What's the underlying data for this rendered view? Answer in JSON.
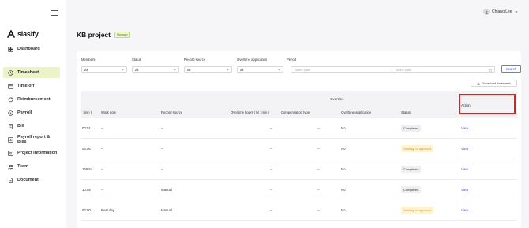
{
  "sidebar": {
    "logo": "slasify",
    "items": [
      {
        "label": "Dashboard",
        "icon": "dashboard-icon"
      },
      {
        "label": "Timesheet",
        "icon": "clock-icon"
      },
      {
        "label": "Time off",
        "icon": "calendar-icon"
      },
      {
        "label": "Reimbursement",
        "icon": "refresh-icon"
      },
      {
        "label": "Payroll",
        "icon": "payroll-icon"
      },
      {
        "label": "Bill",
        "icon": "bill-icon"
      },
      {
        "label": "Payroll report & Bills",
        "icon": "report-icon"
      },
      {
        "label": "Project Information",
        "icon": "project-icon"
      },
      {
        "label": "Team",
        "icon": "team-icon"
      },
      {
        "label": "Document",
        "icon": "document-icon"
      }
    ],
    "active": "Timesheet"
  },
  "header": {
    "user_name": "Chiang Lee"
  },
  "page": {
    "title": "KB project",
    "role_badge": "Manager"
  },
  "filters": {
    "members": {
      "label": "Members",
      "value": "All"
    },
    "status": {
      "label": "Status",
      "value": "All"
    },
    "record_source": {
      "label": "Record source",
      "value": "All"
    },
    "overtime_application": {
      "label": "Overtime application",
      "value": "All"
    },
    "period": {
      "label": "Period",
      "start_placeholder": "Select Date",
      "end_placeholder": "Select Date"
    },
    "search_label": "Search"
  },
  "download_label": "Download timesheet",
  "table": {
    "group_header": "Overtime",
    "columns": {
      "hours": "r : min )",
      "work_note": "Work note",
      "record_source": "Record source",
      "overtime_hours": "Overtime hours ( hr : min )",
      "compensation": "Compensation type",
      "overtime_application": "Overtime application",
      "status": "Status",
      "action": "Action"
    },
    "rows": [
      {
        "hours": "00:01",
        "work_note": "--",
        "record_source": "--",
        "overtime_hours": "--",
        "compensation": "--",
        "overtime_application": "No",
        "status": "Completed",
        "status_kind": "completed",
        "action": "View"
      },
      {
        "hours": "06:06",
        "work_note": "--",
        "record_source": "--",
        "overtime_hours": "--",
        "compensation": "--",
        "overtime_application": "No",
        "status": "Waiting for approval",
        "status_kind": "waiting",
        "action": "View"
      },
      {
        "hours": "168:54",
        "work_note": "--",
        "record_source": "--",
        "overtime_hours": "--",
        "compensation": "--",
        "overtime_application": "No",
        "status": "Completed",
        "status_kind": "completed",
        "action": "View"
      },
      {
        "hours": "10:05",
        "work_note": "--",
        "record_source": "Manual",
        "overtime_hours": "--",
        "compensation": "--",
        "overtime_application": "No",
        "status": "Completed",
        "status_kind": "completed",
        "action": "View"
      },
      {
        "hours": "02:00",
        "work_note": "Rest day",
        "record_source": "Manual",
        "overtime_hours": "--",
        "compensation": "--",
        "overtime_application": "No",
        "status": "Waiting for approval",
        "status_kind": "waiting",
        "action": "View"
      }
    ]
  },
  "colors": {
    "active_nav_bg": "#ecf3c9",
    "highlight_border": "#e02020",
    "link": "#3b5bd6",
    "waiting_text": "#d89a19",
    "waiting_bg": "#fff3d6"
  }
}
